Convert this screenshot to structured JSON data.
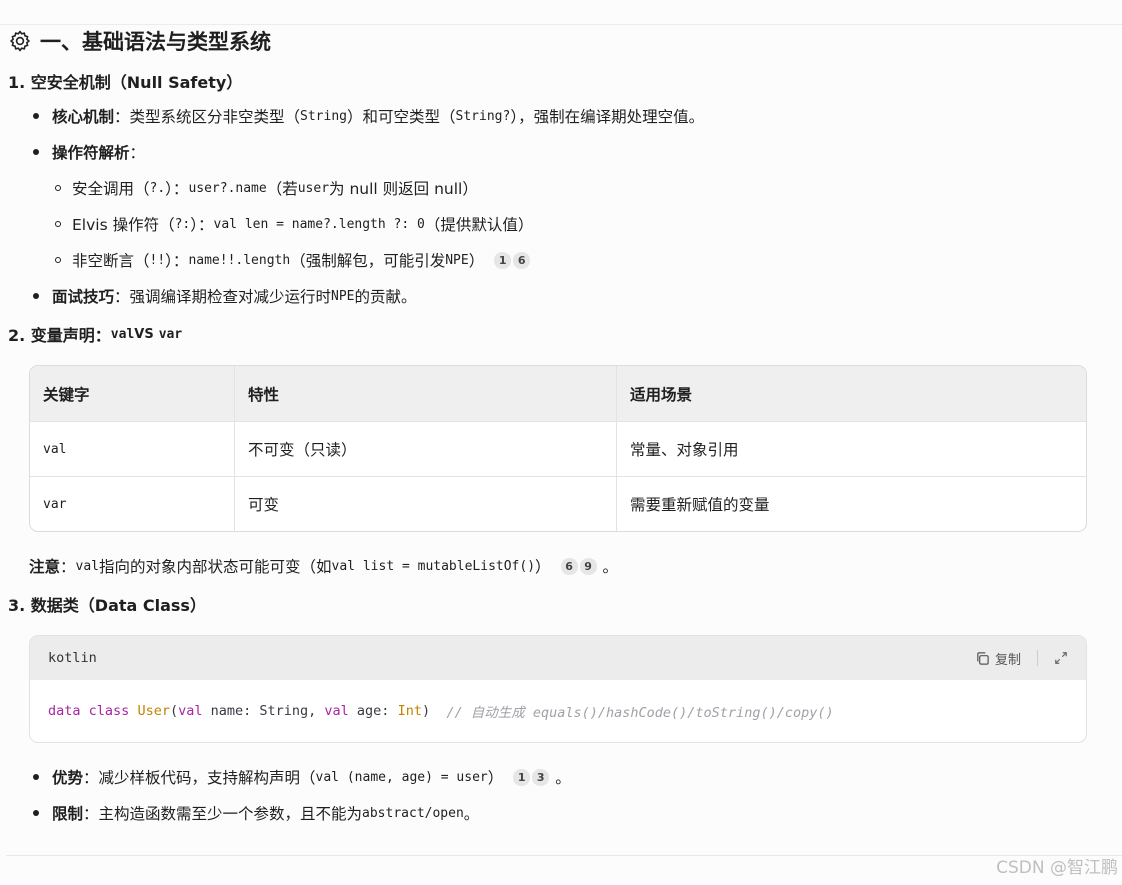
{
  "heading": "一、基础语法与类型系统",
  "s1": {
    "title": "1. 空安全机制（Null Safety）",
    "core_label": "核心机制",
    "core_a": "：类型系统区分非空类型（",
    "core_code1": "String",
    "core_b": "）和可空类型（",
    "core_code2": "String?",
    "core_c": "），强制在编译期处理空值。",
    "ops_label": "操作符解析",
    "ops_colon": "：",
    "sub1_a": "安全调用（",
    "sub1_op": "?.",
    "sub1_b": "）：",
    "sub1_code": "user?.name",
    "sub1_c": "（若 ",
    "sub1_code2": "user",
    "sub1_d": "为 null 则返回 null）",
    "sub2_a": "Elvis 操作符（",
    "sub2_op": "?:",
    "sub2_b": "）：",
    "sub2_code": "val len = name?.length ?: 0",
    "sub2_c": "（提供默认值）",
    "sub3_a": "非空断言（",
    "sub3_op": "!!",
    "sub3_b": "）：",
    "sub3_code": "name!!.length",
    "sub3_c": "（强制解包，可能引发 ",
    "sub3_code2": "NPE",
    "sub3_d": "）",
    "sub3_cites": [
      "1",
      "6"
    ],
    "tip_label": "面试技巧",
    "tip_a": "：强调编译期检查对减少运行时 ",
    "tip_code": "NPE",
    "tip_b": "的贡献。"
  },
  "s2": {
    "title_a": "2. 变量声明：",
    "title_code1": "val",
    "title_vs": "VS",
    "title_code2": "var",
    "table": {
      "headers": [
        "关键字",
        "特性",
        "适用场景"
      ],
      "rows": [
        [
          "val",
          "不可变（只读）",
          "常量、对象引用"
        ],
        [
          "var",
          "可变",
          "需要重新赋值的变量"
        ]
      ]
    },
    "note_label": "注意",
    "note_a": "：",
    "note_code1": "val",
    "note_b": "指向的对象内部状态可能可变（如 ",
    "note_code2": "val list = mutableListOf()",
    "note_c": "）",
    "note_cites": [
      "6",
      "9"
    ],
    "note_end": "。"
  },
  "s3": {
    "title": "3. 数据类（Data Class）",
    "code_lang": "kotlin",
    "copy_label": "复制",
    "code": {
      "k1": "data",
      "k2": "class",
      "t1": "User",
      "p1": "(",
      "k3": "val",
      "p2": " name: String, ",
      "k4": "val",
      "p3": " age: ",
      "t2": "Int",
      "p4": ")  ",
      "comment": "// 自动生成 equals()/hashCode()/toString()/copy()"
    },
    "adv_label": "优势",
    "adv_a": "：减少样板代码，支持解构声明（",
    "adv_code": "val (name, age) = user",
    "adv_b": "）",
    "adv_cites": [
      "1",
      "3"
    ],
    "adv_end": "。",
    "lim_label": "限制",
    "lim_a": "：主构造函数需至少一个参数，且不能为 ",
    "lim_code": "abstract/open",
    "lim_b": "。"
  },
  "watermark": "CSDN @智江鹏"
}
